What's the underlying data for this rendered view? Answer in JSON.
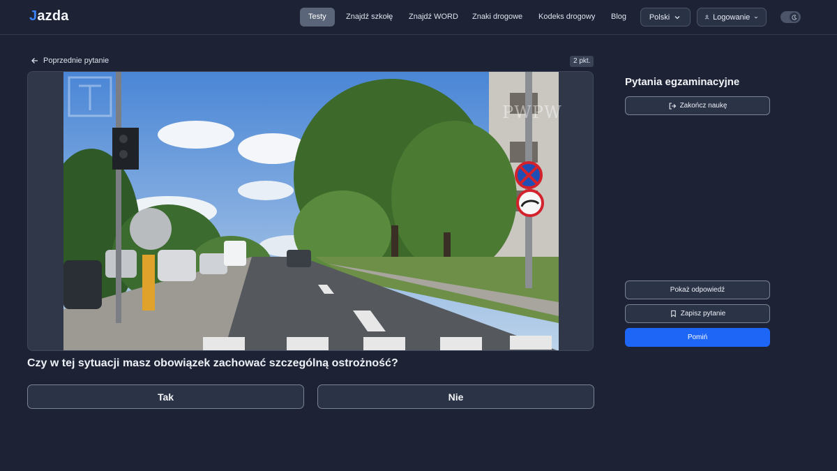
{
  "brand": {
    "logo_mark": "J",
    "logo_rest": "azda"
  },
  "nav": {
    "items": [
      "Testy",
      "Znajdź szkołę",
      "Znajdź WORD",
      "Znaki drogowe",
      "Kodeks drogowy",
      "Blog"
    ],
    "active": "Testy",
    "language": "Polski",
    "login": "Logowanie"
  },
  "question_view": {
    "prev_label": "Poprzednie pytanie",
    "points": "2 pkt.",
    "watermark_right": "PWPW",
    "question": "Czy w tej sytuacji masz obowiązek zachować szczególną ostrożność?",
    "answers": [
      "Tak",
      "Nie"
    ]
  },
  "sidebar": {
    "title": "Pytania egzaminacyjne",
    "end_label": "Zakończ naukę",
    "show_answer_label": "Pokaż odpowiedź",
    "save_label": "Zapisz pytanie",
    "skip_label": "Pomiń"
  },
  "icons": {
    "back": "arrow-left-icon",
    "chevron": "chevron-down-icon",
    "user": "user-icon",
    "theme": "moon-icon",
    "exit": "log-out-icon",
    "bookmark": "bookmark-icon"
  },
  "colors": {
    "accent": "#1e66f5",
    "background": "#1d2335",
    "active_nav": "#5b6579"
  }
}
